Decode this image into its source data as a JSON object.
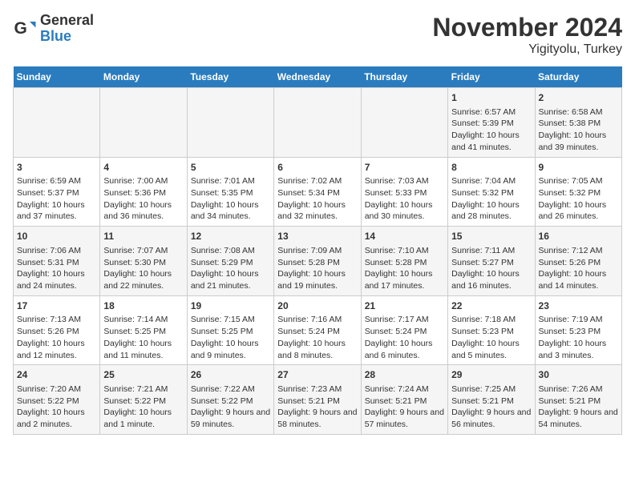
{
  "header": {
    "logo_general": "General",
    "logo_blue": "Blue",
    "title": "November 2024",
    "subtitle": "Yigityolu, Turkey"
  },
  "days_of_week": [
    "Sunday",
    "Monday",
    "Tuesday",
    "Wednesday",
    "Thursday",
    "Friday",
    "Saturday"
  ],
  "weeks": [
    [
      {
        "day": "",
        "info": ""
      },
      {
        "day": "",
        "info": ""
      },
      {
        "day": "",
        "info": ""
      },
      {
        "day": "",
        "info": ""
      },
      {
        "day": "",
        "info": ""
      },
      {
        "day": "1",
        "info": "Sunrise: 6:57 AM\nSunset: 5:39 PM\nDaylight: 10 hours and 41 minutes."
      },
      {
        "day": "2",
        "info": "Sunrise: 6:58 AM\nSunset: 5:38 PM\nDaylight: 10 hours and 39 minutes."
      }
    ],
    [
      {
        "day": "3",
        "info": "Sunrise: 6:59 AM\nSunset: 5:37 PM\nDaylight: 10 hours and 37 minutes."
      },
      {
        "day": "4",
        "info": "Sunrise: 7:00 AM\nSunset: 5:36 PM\nDaylight: 10 hours and 36 minutes."
      },
      {
        "day": "5",
        "info": "Sunrise: 7:01 AM\nSunset: 5:35 PM\nDaylight: 10 hours and 34 minutes."
      },
      {
        "day": "6",
        "info": "Sunrise: 7:02 AM\nSunset: 5:34 PM\nDaylight: 10 hours and 32 minutes."
      },
      {
        "day": "7",
        "info": "Sunrise: 7:03 AM\nSunset: 5:33 PM\nDaylight: 10 hours and 30 minutes."
      },
      {
        "day": "8",
        "info": "Sunrise: 7:04 AM\nSunset: 5:32 PM\nDaylight: 10 hours and 28 minutes."
      },
      {
        "day": "9",
        "info": "Sunrise: 7:05 AM\nSunset: 5:32 PM\nDaylight: 10 hours and 26 minutes."
      }
    ],
    [
      {
        "day": "10",
        "info": "Sunrise: 7:06 AM\nSunset: 5:31 PM\nDaylight: 10 hours and 24 minutes."
      },
      {
        "day": "11",
        "info": "Sunrise: 7:07 AM\nSunset: 5:30 PM\nDaylight: 10 hours and 22 minutes."
      },
      {
        "day": "12",
        "info": "Sunrise: 7:08 AM\nSunset: 5:29 PM\nDaylight: 10 hours and 21 minutes."
      },
      {
        "day": "13",
        "info": "Sunrise: 7:09 AM\nSunset: 5:28 PM\nDaylight: 10 hours and 19 minutes."
      },
      {
        "day": "14",
        "info": "Sunrise: 7:10 AM\nSunset: 5:28 PM\nDaylight: 10 hours and 17 minutes."
      },
      {
        "day": "15",
        "info": "Sunrise: 7:11 AM\nSunset: 5:27 PM\nDaylight: 10 hours and 16 minutes."
      },
      {
        "day": "16",
        "info": "Sunrise: 7:12 AM\nSunset: 5:26 PM\nDaylight: 10 hours and 14 minutes."
      }
    ],
    [
      {
        "day": "17",
        "info": "Sunrise: 7:13 AM\nSunset: 5:26 PM\nDaylight: 10 hours and 12 minutes."
      },
      {
        "day": "18",
        "info": "Sunrise: 7:14 AM\nSunset: 5:25 PM\nDaylight: 10 hours and 11 minutes."
      },
      {
        "day": "19",
        "info": "Sunrise: 7:15 AM\nSunset: 5:25 PM\nDaylight: 10 hours and 9 minutes."
      },
      {
        "day": "20",
        "info": "Sunrise: 7:16 AM\nSunset: 5:24 PM\nDaylight: 10 hours and 8 minutes."
      },
      {
        "day": "21",
        "info": "Sunrise: 7:17 AM\nSunset: 5:24 PM\nDaylight: 10 hours and 6 minutes."
      },
      {
        "day": "22",
        "info": "Sunrise: 7:18 AM\nSunset: 5:23 PM\nDaylight: 10 hours and 5 minutes."
      },
      {
        "day": "23",
        "info": "Sunrise: 7:19 AM\nSunset: 5:23 PM\nDaylight: 10 hours and 3 minutes."
      }
    ],
    [
      {
        "day": "24",
        "info": "Sunrise: 7:20 AM\nSunset: 5:22 PM\nDaylight: 10 hours and 2 minutes."
      },
      {
        "day": "25",
        "info": "Sunrise: 7:21 AM\nSunset: 5:22 PM\nDaylight: 10 hours and 1 minute."
      },
      {
        "day": "26",
        "info": "Sunrise: 7:22 AM\nSunset: 5:22 PM\nDaylight: 9 hours and 59 minutes."
      },
      {
        "day": "27",
        "info": "Sunrise: 7:23 AM\nSunset: 5:21 PM\nDaylight: 9 hours and 58 minutes."
      },
      {
        "day": "28",
        "info": "Sunrise: 7:24 AM\nSunset: 5:21 PM\nDaylight: 9 hours and 57 minutes."
      },
      {
        "day": "29",
        "info": "Sunrise: 7:25 AM\nSunset: 5:21 PM\nDaylight: 9 hours and 56 minutes."
      },
      {
        "day": "30",
        "info": "Sunrise: 7:26 AM\nSunset: 5:21 PM\nDaylight: 9 hours and 54 minutes."
      }
    ]
  ]
}
